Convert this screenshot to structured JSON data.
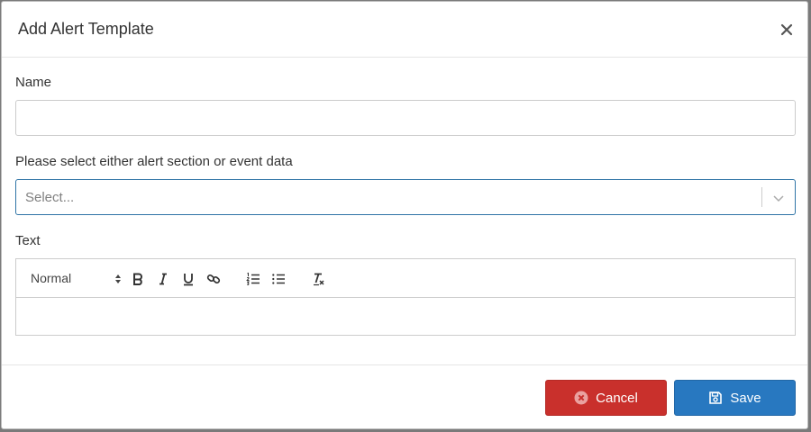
{
  "dialog": {
    "title": "Add Alert Template"
  },
  "form": {
    "name_label": "Name",
    "name_value": "",
    "section_label": "Please select either alert section or event data",
    "section_placeholder": "Select...",
    "text_label": "Text"
  },
  "editor": {
    "format_value": "Normal",
    "tools": [
      "bold-icon",
      "italic-icon",
      "underline-icon",
      "link-icon",
      "ordered-list-icon",
      "bullet-list-icon",
      "clear-format-icon"
    ]
  },
  "footer": {
    "cancel_label": "Cancel",
    "save_label": "Save"
  },
  "colors": {
    "cancel": "#c9302c",
    "save": "#2878c0",
    "select_border": "#2f74a6"
  }
}
